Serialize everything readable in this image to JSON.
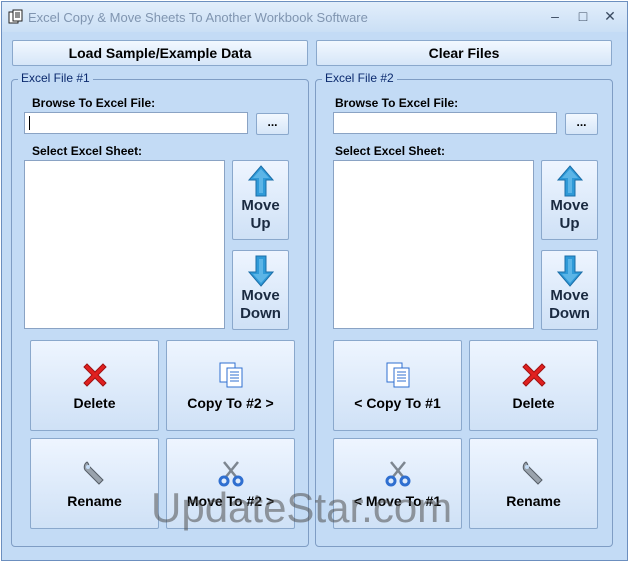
{
  "window": {
    "title": "Excel Copy & Move Sheets To Another Workbook Software",
    "minimize_symbol": "–",
    "maximize_symbol": "□",
    "close_symbol": "✕"
  },
  "toolbar": {
    "load_sample_label": "Load Sample/Example Data",
    "clear_files_label": "Clear Files"
  },
  "file1": {
    "group_label": "Excel File #1",
    "browse_label": "Browse To Excel File:",
    "path_value": "",
    "browse_button": "...",
    "select_sheet_label": "Select Excel Sheet:",
    "move_up_label": "Move\nUp",
    "move_down_label": "Move\nDown",
    "delete_label": "Delete",
    "copy_label": "Copy To #2 >",
    "rename_label": "Rename",
    "move_label": "Move To #2 >"
  },
  "file2": {
    "group_label": "Excel File #2",
    "browse_label": "Browse To Excel File:",
    "path_value": "",
    "browse_button": "...",
    "select_sheet_label": "Select Excel Sheet:",
    "move_up_label": "Move\nUp",
    "move_down_label": "Move\nDown",
    "copy_label": "< Copy To #1",
    "delete_label": "Delete",
    "move_label": "< Move To #1",
    "rename_label": "Rename"
  },
  "watermark": "UpdateStar.com",
  "colors": {
    "window_bg": "#c3dbf5",
    "arrow_blue": "#2f9ad8",
    "delete_red": "#e02020",
    "scissors_blue": "#2f6fd0"
  }
}
